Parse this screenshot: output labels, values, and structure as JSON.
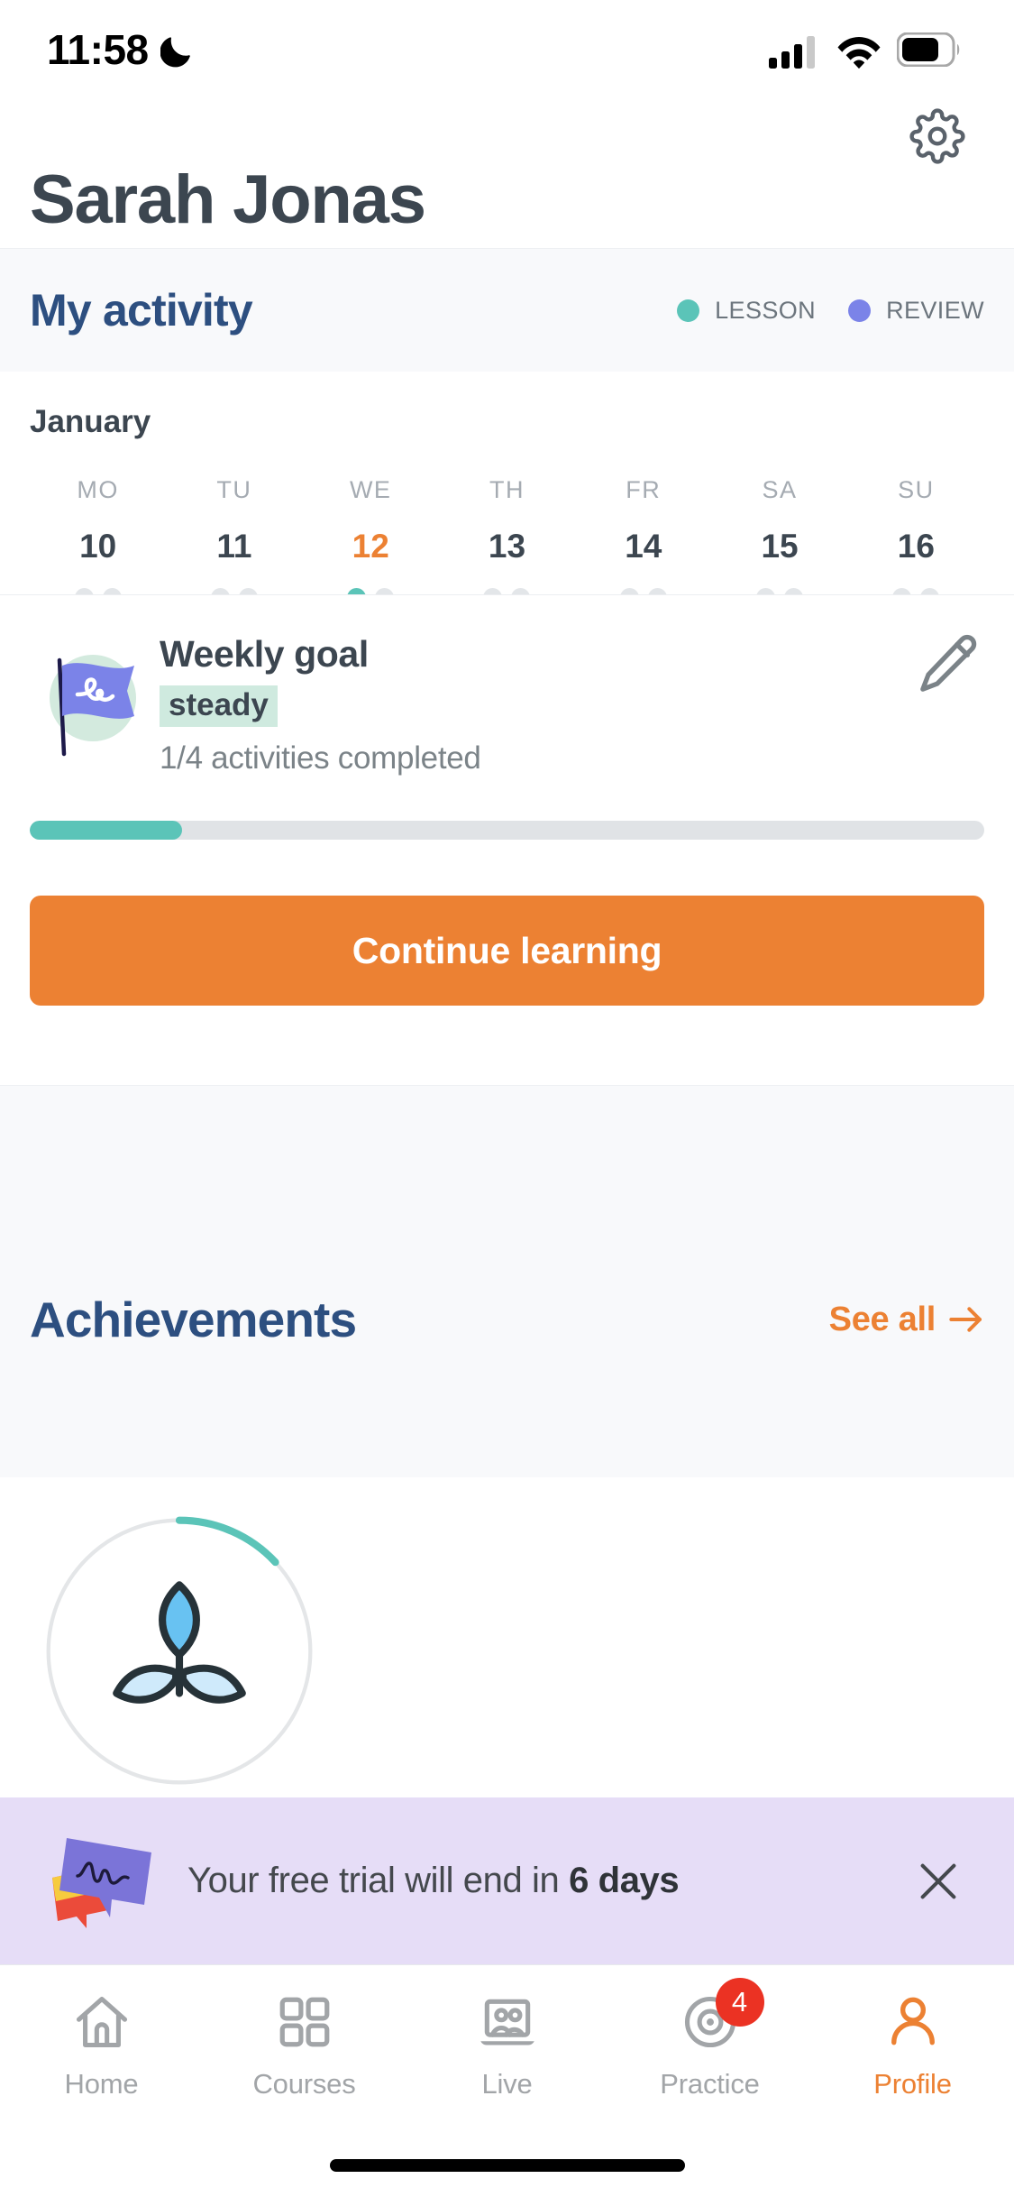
{
  "status_bar": {
    "time": "11:58",
    "dnd_icon": "moon-icon",
    "signal_icon": "cellular-signal-icon",
    "signal_bars_filled": 3,
    "signal_bars_total": 4,
    "wifi_icon": "wifi-icon",
    "battery_icon": "battery-icon",
    "battery_level_pct": 65
  },
  "header": {
    "settings_icon": "gear-icon",
    "user_name": "Sarah Jonas"
  },
  "activity": {
    "title": "My activity",
    "legend": [
      {
        "label": "LESSON",
        "color": "#5bc4b8",
        "key": "lesson"
      },
      {
        "label": "REVIEW",
        "color": "#7b83e8",
        "key": "review"
      }
    ]
  },
  "calendar": {
    "month": "January",
    "days": [
      {
        "dow": "MO",
        "num": "10",
        "today": false,
        "dots": [
          "empty",
          "empty"
        ]
      },
      {
        "dow": "TU",
        "num": "11",
        "today": false,
        "dots": [
          "empty",
          "empty"
        ]
      },
      {
        "dow": "WE",
        "num": "12",
        "today": true,
        "dots": [
          "lesson",
          "empty"
        ]
      },
      {
        "dow": "TH",
        "num": "13",
        "today": false,
        "dots": [
          "empty",
          "empty"
        ]
      },
      {
        "dow": "FR",
        "num": "14",
        "today": false,
        "dots": [
          "empty",
          "empty"
        ]
      },
      {
        "dow": "SA",
        "num": "15",
        "today": false,
        "dots": [
          "empty",
          "empty"
        ]
      },
      {
        "dow": "SU",
        "num": "16",
        "today": false,
        "dots": [
          "empty",
          "empty"
        ]
      }
    ]
  },
  "weekly_goal": {
    "icon": "flag-icon",
    "title": "Weekly goal",
    "badge": "steady",
    "subtitle": "1/4 activities completed",
    "edit_icon": "pencil-icon",
    "progress_pct": 16,
    "completed": 1,
    "total": 4,
    "progress_color": "#5bc4b8",
    "badge_bg_color": "#cfeadf"
  },
  "continue": {
    "label": "Continue learning",
    "color": "#ec8133"
  },
  "achievements": {
    "title": "Achievements",
    "see_all_label": "See all",
    "see_all_arrow": "arrow-right-icon",
    "accent_color": "#ec8133",
    "badge": {
      "name": "sprout-achievement-badge",
      "progress_pct": 18,
      "ring_color": "#5bc4b8",
      "ring_track_color": "#e4e6e8"
    }
  },
  "trial_banner": {
    "icon": "speech-bubble-icon",
    "text_prefix": "Your free trial will end in ",
    "text_highlight": "6 days",
    "close_icon": "close-icon",
    "background_color": "#e6ddf7"
  },
  "bottom_nav": {
    "items": [
      {
        "label": "Home",
        "icon": "home-icon",
        "active": false,
        "badge": null
      },
      {
        "label": "Courses",
        "icon": "grid-icon",
        "active": false,
        "badge": null
      },
      {
        "label": "Live",
        "icon": "live-icon",
        "active": false,
        "badge": null
      },
      {
        "label": "Practice",
        "icon": "target-icon",
        "active": false,
        "badge": "4"
      },
      {
        "label": "Profile",
        "icon": "person-icon",
        "active": true,
        "badge": null
      }
    ],
    "active_color": "#ec8133",
    "inactive_color": "#a2a5a8",
    "badge_color": "#eb3223"
  }
}
